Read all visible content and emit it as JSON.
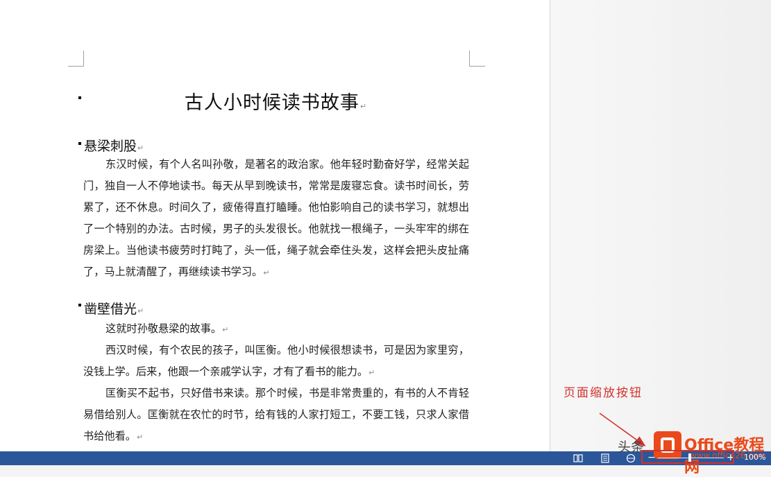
{
  "document": {
    "title": "古人小时候读书故事",
    "sections": [
      {
        "heading": "悬梁刺股",
        "paragraphs": [
          "东汉时候，有个人名叫孙敬，是著名的政治家。他年轻时勤奋好学，经常关起门，独自一人不停地读书。每天从早到晚读书，常常是废寝忘食。读书时间长，劳累了，还不休息。时间久了，疲倦得直打瞌睡。他怕影响自己的读书学习，就想出了一个特别的办法。古时候，男子的头发很长。他就找一根绳子，一头牢牢的绑在房梁上。当他读书疲劳时打盹了，头一低，绳子就会牵住头发，这样会把头皮扯痛了，马上就清醒了，再继续读书学习。"
        ]
      },
      {
        "heading": "凿壁借光",
        "paragraphs": [
          "这就时孙敬悬梁的故事。",
          "西汉时候，有个农民的孩子，叫匡衡。他小时候很想读书，可是因为家里穷，没钱上学。后来，他跟一个亲戚学认字，才有了看书的能力。",
          "匡衡买不起书，只好借书来读。那个时候，书是非常贵重的，有书的人不肯轻易借给别人。匡衡就在农忙的时节，给有钱的人家打短工，不要工钱，只求人家借书给他看。"
        ]
      }
    ],
    "paragraph_mark": "↵"
  },
  "annotation": {
    "label": "页面缩放按钮",
    "color": "#d2322d"
  },
  "statusbar": {
    "zoom_level": "100%",
    "zoom_out_label": "−",
    "zoom_in_label": "+",
    "icons": [
      "read-mode-icon",
      "print-layout-icon",
      "web-layout-icon"
    ],
    "accent": "#2b579a"
  },
  "watermark": {
    "prefix": "头条",
    "title": "Office教程网",
    "url": "www.office26.com"
  }
}
